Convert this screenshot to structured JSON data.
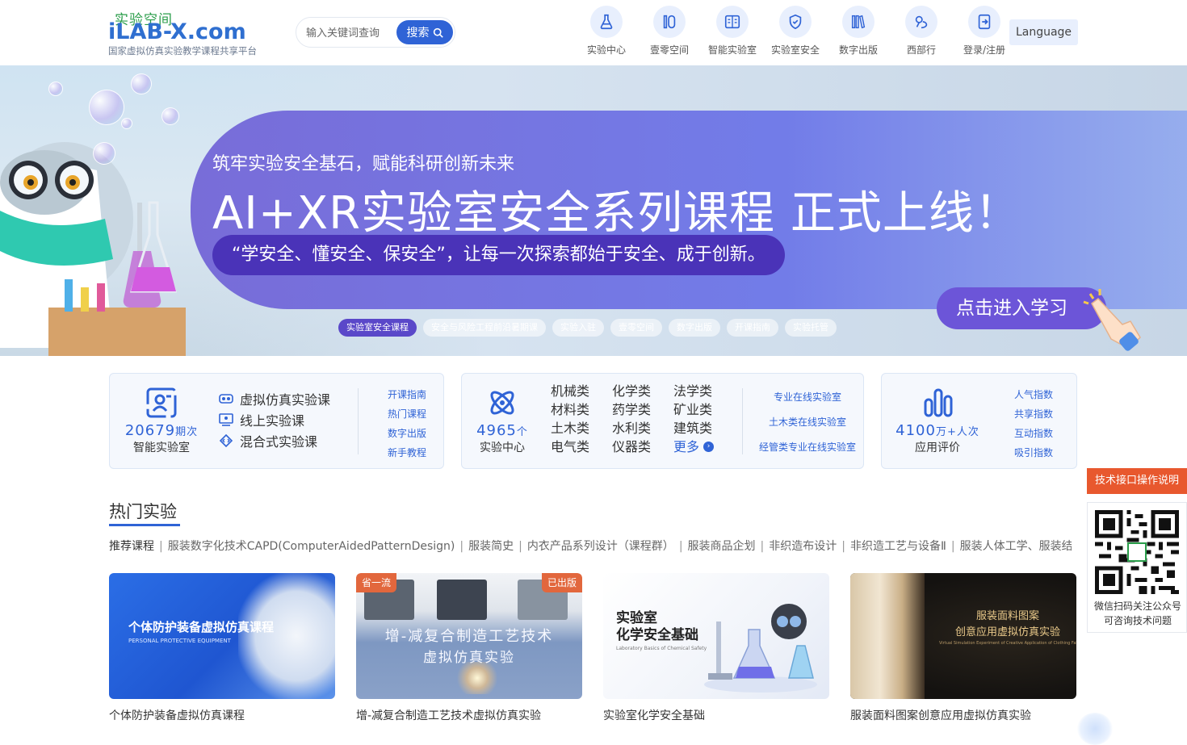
{
  "logo": {
    "cn": "实验空间",
    "en_prefix": "iLAB-X",
    "en_suffix": ".com",
    "subtitle": "国家虚拟仿真实验教学课程共享平台"
  },
  "search": {
    "placeholder": "输入关键词查询",
    "button_label": "搜索"
  },
  "nav": [
    {
      "label": "实验中心",
      "icon": "flask-icon"
    },
    {
      "label": "壹零空间",
      "icon": "one-zero-icon"
    },
    {
      "label": "智能实验室",
      "icon": "smart-lab-icon"
    },
    {
      "label": "实验室安全",
      "icon": "shield-icon"
    },
    {
      "label": "数字出版",
      "icon": "books-vr-icon"
    },
    {
      "label": "西部行",
      "icon": "map-pin-icon"
    },
    {
      "label": "登录/注册",
      "icon": "login-icon"
    }
  ],
  "language_label": "Language",
  "banner": {
    "subtitle": "筑牢实验安全基石，赋能科研创新未来",
    "title": "AI+XR实验室安全系列课程  正式上线！",
    "quote": "“学安全、懂安全、保安全”，让每一次探索都始于安全、成于创新。",
    "cta": "点击进入学习",
    "tabs": [
      "实验室安全课程",
      "安全与风险工程前沿暑期课",
      "实验入驻",
      "壹零空间",
      "数字出版",
      "开课指南",
      "实验托管"
    ],
    "active_tab": 0
  },
  "card1": {
    "number": "20679",
    "unit": "期次",
    "caption": "智能实验室",
    "items": [
      {
        "label": "虚拟仿真实验课",
        "icon": "vr-glasses-icon"
      },
      {
        "label": "线上实验课",
        "icon": "online-class-icon"
      },
      {
        "label": "混合式实验课",
        "icon": "hybrid-icon"
      }
    ],
    "links": [
      "开课指南",
      "热门课程",
      "数字出版",
      "新手教程"
    ]
  },
  "card2": {
    "number": "4965",
    "unit": "个",
    "caption": "实验中心",
    "categories": [
      "机械类",
      "化学类",
      "法学类",
      "材料类",
      "药学类",
      "矿业类",
      "土木类",
      "水利类",
      "建筑类",
      "电气类",
      "仪器类"
    ],
    "more_label": "更多",
    "links": [
      "专业在线实验室",
      "土木类在线实验室",
      "经管类专业在线实验室"
    ]
  },
  "card3": {
    "number": "4100",
    "unit": "万+人次",
    "caption": "应用评价",
    "links": [
      "人气指数",
      "共享指数",
      "互动指数",
      "吸引指数"
    ]
  },
  "hot": {
    "title": "热门实验",
    "tags": [
      "推荐课程",
      "服装数字化技术CAPD(ComputerAidedPatternDesign)",
      "服装简史",
      "内衣产品系列设计（课程群）",
      "服装商品企划",
      "非织造布设计",
      "非织造工艺与设备Ⅱ",
      "服装人体工学、服装结构设计"
    ],
    "courses": [
      {
        "title": "个体防护装备虚拟仿真课程",
        "cover_title": "个体防护装备虚拟仿真课程",
        "cover_sub": "PERSONAL PROTECTIVE EQUIPMENT",
        "badge_left": "",
        "badge_right": ""
      },
      {
        "title": "增-减复合制造工艺技术虚拟仿真实验",
        "cover_title": "增-减复合制造工艺技术",
        "cover_sub": "虚拟仿真实验",
        "badge_left": "省一流",
        "badge_right": "已出版"
      },
      {
        "title": "实验室化学安全基础",
        "cover_title": "实验室\n化学安全基础",
        "cover_sub": "Laboratory Basics of Chemical Safety",
        "badge_left": "",
        "badge_right": ""
      },
      {
        "title": "服装面料图案创意应用虚拟仿真实验",
        "cover_title": "服装面料图案\n创意应用虚拟仿真实验",
        "cover_sub": "Virtual Simulation Experiment of Creative Application of Clothing Fabric Pattern",
        "badge_left": "",
        "badge_right": ""
      }
    ]
  },
  "side": {
    "tech_button": "技术接口操作说明",
    "qr_text": "微信扫码关注公众号可咨询技术问题"
  },
  "colors": {
    "primary": "#2f63d6",
    "accent_green": "#2a9d4a",
    "orange": "#e8582e",
    "banner_purple": "#6c55d8"
  }
}
